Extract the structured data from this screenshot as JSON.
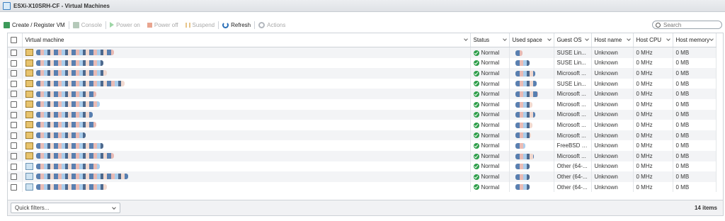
{
  "window": {
    "title": "ESXi-X10SRH-CF - Virtual Machines"
  },
  "toolbar": {
    "create": "Create / Register VM",
    "console": "Console",
    "power_on": "Power on",
    "power_off": "Power off",
    "suspend": "Suspend",
    "refresh": "Refresh",
    "actions": "Actions"
  },
  "search": {
    "placeholder": "Search"
  },
  "columns": {
    "vm": "Virtual machine",
    "status": "Status",
    "used_space": "Used space",
    "guest_os": "Guest OS",
    "host_name": "Host name",
    "host_cpu": "Host CPU",
    "host_memory": "Host memory"
  },
  "rows": [
    {
      "status": "Normal",
      "guest_os": "SUSE Lin...",
      "host_name": "Unknown",
      "host_cpu": "0 MHz",
      "host_memory": "0 MB"
    },
    {
      "status": "Normal",
      "guest_os": "SUSE Lin...",
      "host_name": "Unknown",
      "host_cpu": "0 MHz",
      "host_memory": "0 MB"
    },
    {
      "status": "Normal",
      "guest_os": "Microsoft ...",
      "host_name": "Unknown",
      "host_cpu": "0 MHz",
      "host_memory": "0 MB"
    },
    {
      "status": "Normal",
      "guest_os": "SUSE Lin...",
      "host_name": "Unknown",
      "host_cpu": "0 MHz",
      "host_memory": "0 MB"
    },
    {
      "status": "Normal",
      "guest_os": "Microsoft ...",
      "host_name": "Unknown",
      "host_cpu": "0 MHz",
      "host_memory": "0 MB"
    },
    {
      "status": "Normal",
      "guest_os": "Microsoft ...",
      "host_name": "Unknown",
      "host_cpu": "0 MHz",
      "host_memory": "0 MB"
    },
    {
      "status": "Normal",
      "guest_os": "Microsoft ...",
      "host_name": "Unknown",
      "host_cpu": "0 MHz",
      "host_memory": "0 MB"
    },
    {
      "status": "Normal",
      "guest_os": "Microsoft ...",
      "host_name": "Unknown",
      "host_cpu": "0 MHz",
      "host_memory": "0 MB"
    },
    {
      "status": "Normal",
      "guest_os": "Microsoft ...",
      "host_name": "Unknown",
      "host_cpu": "0 MHz",
      "host_memory": "0 MB"
    },
    {
      "status": "Normal",
      "guest_os": "FreeBSD (...",
      "host_name": "Unknown",
      "host_cpu": "0 MHz",
      "host_memory": "0 MB"
    },
    {
      "status": "Normal",
      "guest_os": "Microsoft ...",
      "host_name": "Unknown",
      "host_cpu": "0 MHz",
      "host_memory": "0 MB"
    },
    {
      "status": "Normal",
      "guest_os": "Other (64-...",
      "host_name": "Unknown",
      "host_cpu": "0 MHz",
      "host_memory": "0 MB"
    },
    {
      "status": "Normal",
      "guest_os": "Other (64-...",
      "host_name": "Unknown",
      "host_cpu": "0 MHz",
      "host_memory": "0 MB"
    },
    {
      "status": "Normal",
      "guest_os": "Other (64-...",
      "host_name": "Unknown",
      "host_cpu": "0 MHz",
      "host_memory": "0 MB"
    }
  ],
  "footer": {
    "quick_filters": "Quick filters...",
    "item_count": "14 items"
  }
}
